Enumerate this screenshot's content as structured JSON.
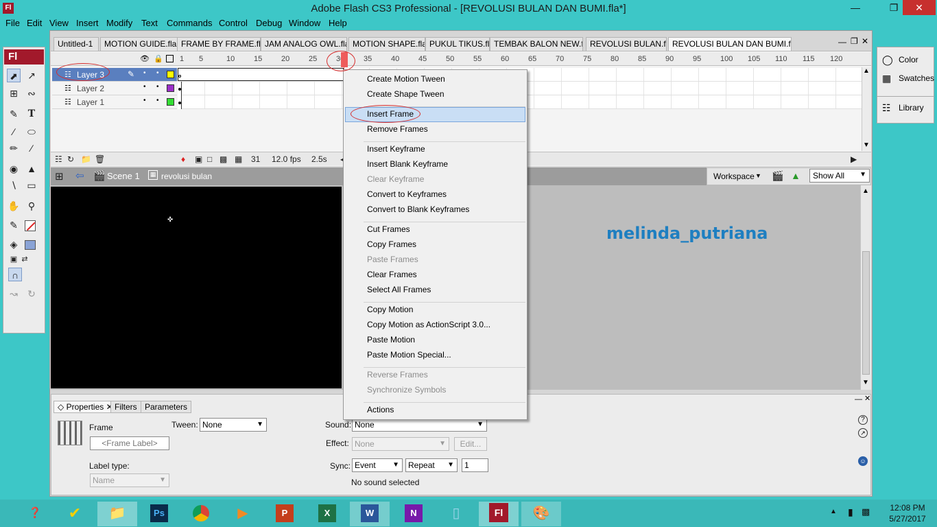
{
  "window": {
    "title": "Adobe Flash CS3 Professional - [REVOLUSI BULAN DAN BUMI.fla*]",
    "app_logo": "Fl"
  },
  "menubar": [
    "File",
    "Edit",
    "View",
    "Insert",
    "Modify",
    "Text",
    "Commands",
    "Control",
    "Debug",
    "Window",
    "Help"
  ],
  "tabs": [
    "Untitled-1",
    "MOTION GUIDE.fla",
    "FRAME BY FRAME.fla",
    "JAM ANALOG OWL.fla",
    "MOTION SHAPE.fla",
    "PUKUL TIKUS.fla",
    "TEMBAK BALON NEW.fla",
    "REVOLUSI BULAN.fla",
    "REVOLUSI BULAN DAN BUMI.fla*"
  ],
  "ruler": [
    "1",
    "5",
    "10",
    "15",
    "20",
    "25",
    "30",
    "35",
    "40",
    "45",
    "50",
    "55",
    "60",
    "65",
    "70",
    "75",
    "80",
    "85",
    "90",
    "95",
    "100",
    "105",
    "110",
    "115",
    "120"
  ],
  "layers": [
    {
      "name": "Layer 3",
      "color": "#ffff00",
      "selected": true
    },
    {
      "name": "Layer 2",
      "color": "#9b30c8",
      "selected": false
    },
    {
      "name": "Layer 1",
      "color": "#33dd33",
      "selected": false
    }
  ],
  "timeline_footer": {
    "frame": "31",
    "fps": "12.0 fps",
    "time": "2.5s"
  },
  "editbar": {
    "scene": "Scene 1",
    "symbol": "revolusi bulan",
    "workspace": "Workspace",
    "zoom": "Show All"
  },
  "watermark": "melinda_putriana",
  "context_menu": {
    "groups": [
      [
        {
          "label": "Create Motion Tween",
          "enabled": true
        },
        {
          "label": "Create Shape Tween",
          "enabled": true
        }
      ],
      [
        {
          "label": "Insert Frame",
          "enabled": true
        },
        {
          "label": "Remove Frames",
          "enabled": true
        }
      ],
      [
        {
          "label": "Insert Keyframe",
          "enabled": true
        },
        {
          "label": "Insert Blank Keyframe",
          "enabled": true
        },
        {
          "label": "Clear Keyframe",
          "enabled": false
        },
        {
          "label": "Convert to Keyframes",
          "enabled": true
        },
        {
          "label": "Convert to Blank Keyframes",
          "enabled": true
        }
      ],
      [
        {
          "label": "Cut Frames",
          "enabled": true
        },
        {
          "label": "Copy Frames",
          "enabled": true
        },
        {
          "label": "Paste Frames",
          "enabled": false
        },
        {
          "label": "Clear Frames",
          "enabled": true
        },
        {
          "label": "Select All Frames",
          "enabled": true
        }
      ],
      [
        {
          "label": "Copy Motion",
          "enabled": true
        },
        {
          "label": "Copy Motion as ActionScript 3.0...",
          "enabled": true
        },
        {
          "label": "Paste Motion",
          "enabled": true
        },
        {
          "label": "Paste Motion Special...",
          "enabled": true
        }
      ],
      [
        {
          "label": "Reverse Frames",
          "enabled": false
        },
        {
          "label": "Synchronize Symbols",
          "enabled": false
        }
      ],
      [
        {
          "label": "Actions",
          "enabled": true
        }
      ]
    ],
    "highlighted": "Insert Frame"
  },
  "properties": {
    "tabs": [
      "Properties",
      "Filters",
      "Parameters"
    ],
    "frame_label": "Frame",
    "frame_label_placeholder": "<Frame Label>",
    "tween_label": "Tween:",
    "tween_value": "None",
    "label_type_label": "Label type:",
    "label_type_value": "Name",
    "sound_label": "Sound:",
    "sound_value": "None",
    "effect_label": "Effect:",
    "effect_value": "None",
    "edit_button": "Edit...",
    "sync_label": "Sync:",
    "sync_value": "Event",
    "repeat_value": "Repeat",
    "repeat_count": "1",
    "status": "No sound selected"
  },
  "right_panel": [
    "Color",
    "Swatches",
    "Library"
  ],
  "taskbar": {
    "apps": [
      "Ps",
      "Fl"
    ],
    "time": "12:08 PM",
    "date": "5/27/2017"
  }
}
